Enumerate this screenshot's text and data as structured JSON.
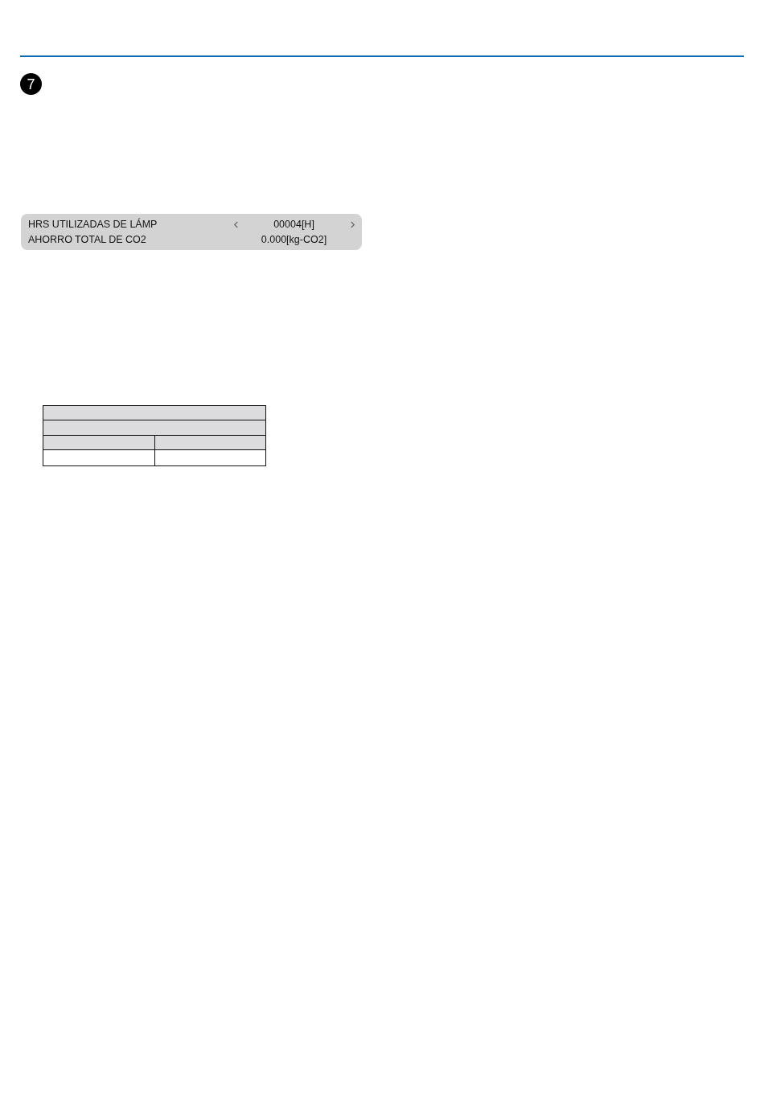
{
  "header": {
    "step_number": "7"
  },
  "menu": {
    "rows": [
      {
        "kind": "adjustable",
        "label": "HRS UTILIZADAS DE LÁMP",
        "value": "00004[H]"
      },
      {
        "kind": "readout",
        "label": "AHORRO TOTAL DE CO2",
        "value": "0.000[kg-CO2]"
      }
    ]
  },
  "table": {
    "rows": [
      {
        "kind": "merged",
        "shaded": true
      },
      {
        "kind": "merged",
        "shaded": true
      },
      {
        "kind": "split",
        "shaded": true
      },
      {
        "kind": "split",
        "shaded": false
      }
    ]
  }
}
